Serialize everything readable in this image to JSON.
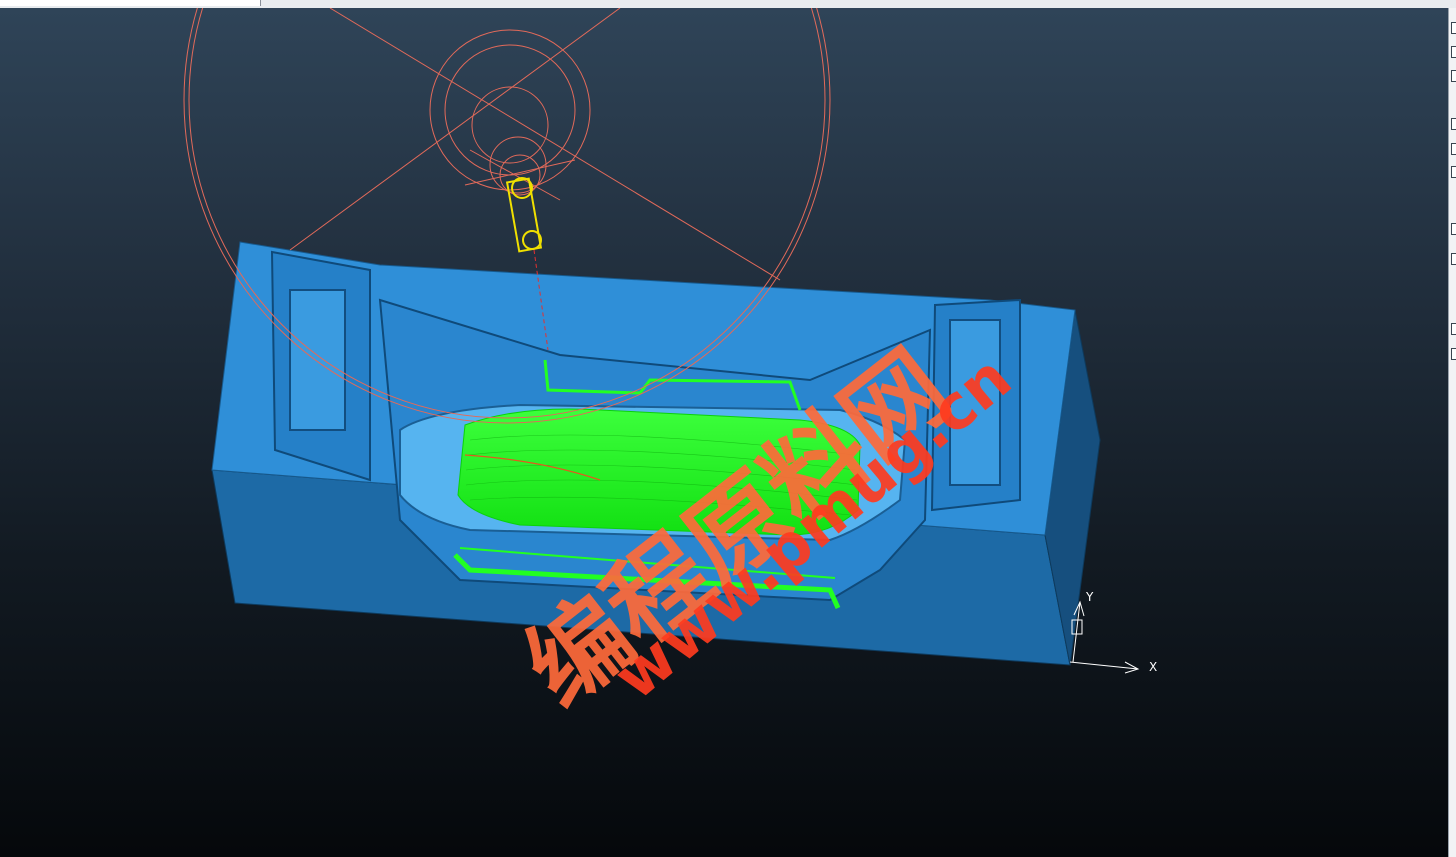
{
  "window": {
    "title": ""
  },
  "viewport": {
    "background_top": "#2f4458",
    "background_bottom": "#05080b"
  },
  "colors": {
    "mold_face": "#2f8fd8",
    "mold_side": "#1f5f92",
    "toolpath": "#22ff22",
    "tool_wireframe": "#e26a5a",
    "tool_holder": "#f0e000",
    "watermark": "#ff3b1f"
  },
  "axes": {
    "x_label": "X",
    "y_label": "Y"
  },
  "watermark": {
    "line1": "编程原料网",
    "line2": "www.pmug.cn"
  },
  "icons": {
    "view_triad": "axis-triad-icon"
  }
}
